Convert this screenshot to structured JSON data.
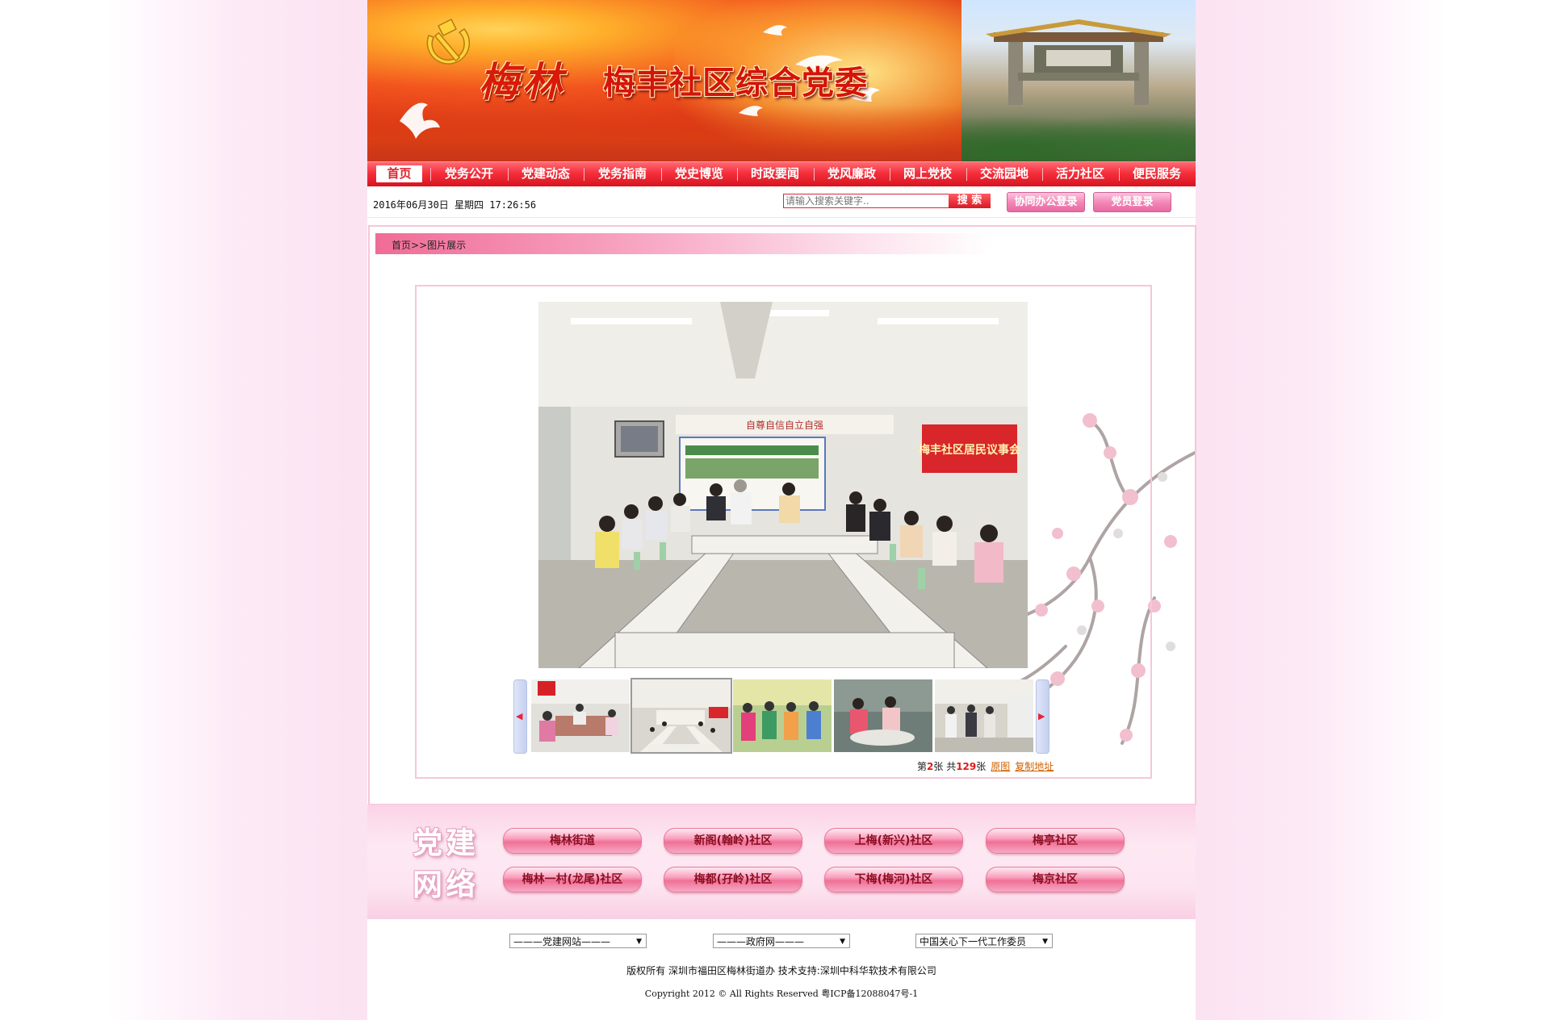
{
  "header": {
    "title_meilin": "梅林",
    "title_main": "梅丰社区综合党委"
  },
  "nav": {
    "items": [
      "首页",
      "党务公开",
      "党建动态",
      "党务指南",
      "党史博览",
      "时政要闻",
      "党风廉政",
      "网上党校",
      "交流园地",
      "活力社区",
      "便民服务"
    ],
    "active_index": 0
  },
  "infobar": {
    "datetime": "2016年06月30日  星期四  17:26:56",
    "search_placeholder": "请输入搜索关键字..",
    "search_button": "搜 索",
    "office_login": "协同办公登录",
    "member_login": "党员登录"
  },
  "breadcrumb": {
    "home": "首页",
    "sep": ">>",
    "current": "图片展示"
  },
  "gallery": {
    "pager_prefix": "第",
    "current": "2",
    "pager_mid": "张  共",
    "total": "129",
    "pager_suffix": "张",
    "original_link": "原图",
    "copy_link": "复制地址",
    "thumbnail_count": 5,
    "selected_thumbnail": 1,
    "banner_text_left": "自尊自信自立自强",
    "banner_text_right": "梅丰社区居民议事会"
  },
  "network": {
    "title_line1": "党建",
    "title_line2": "网络",
    "links": [
      "梅林街道",
      "新阁(翰岭)社区",
      "上梅(新兴)社区",
      "梅亭社区",
      "梅林一村(龙尾)社区",
      "梅都(孖岭)社区",
      "下梅(梅河)社区",
      "梅京社区"
    ]
  },
  "footer": {
    "select1": "———党建网站———",
    "select2": "———政府网———",
    "select3": "中国关心下一代工作委员",
    "copyright_line1": "版权所有  深圳市福田区梅林街道办  技术支持:深圳中科华软技术有限公司",
    "copyright_line2": "Copyright 2012 © All Rights Reserved    粤ICP备12088047号-1"
  },
  "colors": {
    "nav_red": "#e0242e",
    "pink_border": "#f6c7d9",
    "link_orange": "#d06000"
  }
}
